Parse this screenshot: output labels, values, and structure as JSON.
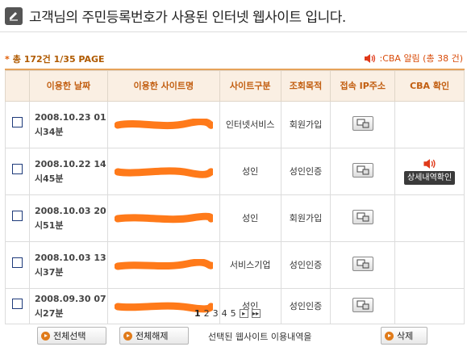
{
  "header": {
    "title": "고객님의 주민등록번호가 사용된 인터넷 웹사이트 입니다.",
    "icon": "edit-icon"
  },
  "summary": {
    "count_text": "총 172건 1/35 PAGE",
    "cba_alert_text": ":CBA 알림 (총 38 건)",
    "accent_color": "#c25e10"
  },
  "table": {
    "columns": [
      "",
      "이용한 날짜",
      "이용한 사이트명",
      "사이트구분",
      "조회목적",
      "접속 IP주소",
      "CBA 확인"
    ],
    "rows": [
      {
        "date": "2008.10.23 01시34분",
        "category": "인터넷서비스",
        "purpose": "회원가입",
        "has_cba": false
      },
      {
        "date": "2008.10.22 14시45분",
        "category": "성인",
        "purpose": "성인인증",
        "has_cba": true,
        "cba_button": "상세내역확인"
      },
      {
        "date": "2008.10.03 20시51분",
        "category": "성인",
        "purpose": "회원가입",
        "has_cba": false
      },
      {
        "date": "2008.10.03 13시37분",
        "category": "서비스기업",
        "purpose": "성인인증",
        "has_cba": false
      },
      {
        "date": "2008.09.30 07시27분",
        "category": "성인",
        "purpose": "성인인증",
        "has_cba": false
      }
    ]
  },
  "pagination": {
    "pages": [
      "1",
      "2",
      "3",
      "4",
      "5"
    ],
    "current": "1",
    "next_label": "▸",
    "last_label": "▸▸"
  },
  "footer": {
    "select_all": "전체선택",
    "deselect_all": "전체해제",
    "description": "선택된 웹사이트 이용내역을",
    "delete": "삭제"
  }
}
